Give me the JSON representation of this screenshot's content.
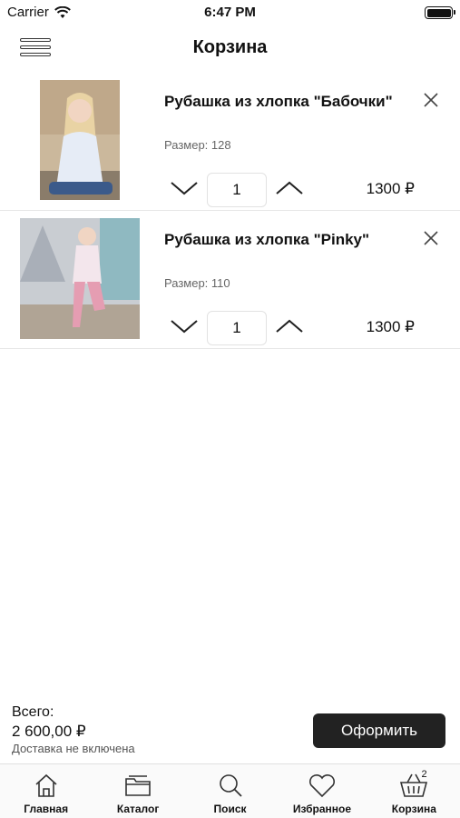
{
  "status": {
    "carrier": "Carrier",
    "time": "6:47 PM"
  },
  "nav": {
    "title": "Корзина"
  },
  "cart": {
    "items": [
      {
        "title": "Рубашка из хлопка \"Бабочки\"",
        "size": "Размер: 128",
        "quantity": "1",
        "price": "1300 ₽"
      },
      {
        "title": "Рубашка из хлопка \"Pinky\"",
        "size": "Размер: 110",
        "quantity": "1",
        "price": "1300 ₽"
      }
    ]
  },
  "summary": {
    "total_label": "Всего:",
    "total_value": "2 600,00 ₽",
    "delivery_note": "Доставка не включена",
    "checkout_label": "Оформить"
  },
  "tabs": [
    {
      "label": "Главная",
      "icon": "home-icon"
    },
    {
      "label": "Каталог",
      "icon": "folder-icon"
    },
    {
      "label": "Поиск",
      "icon": "search-icon"
    },
    {
      "label": "Избранное",
      "icon": "heart-icon"
    },
    {
      "label": "Корзина",
      "icon": "basket-icon",
      "badge": "2"
    }
  ],
  "colors": {
    "accent": "#222222",
    "divider": "#e6e6e6",
    "secondary_text": "#666666"
  }
}
